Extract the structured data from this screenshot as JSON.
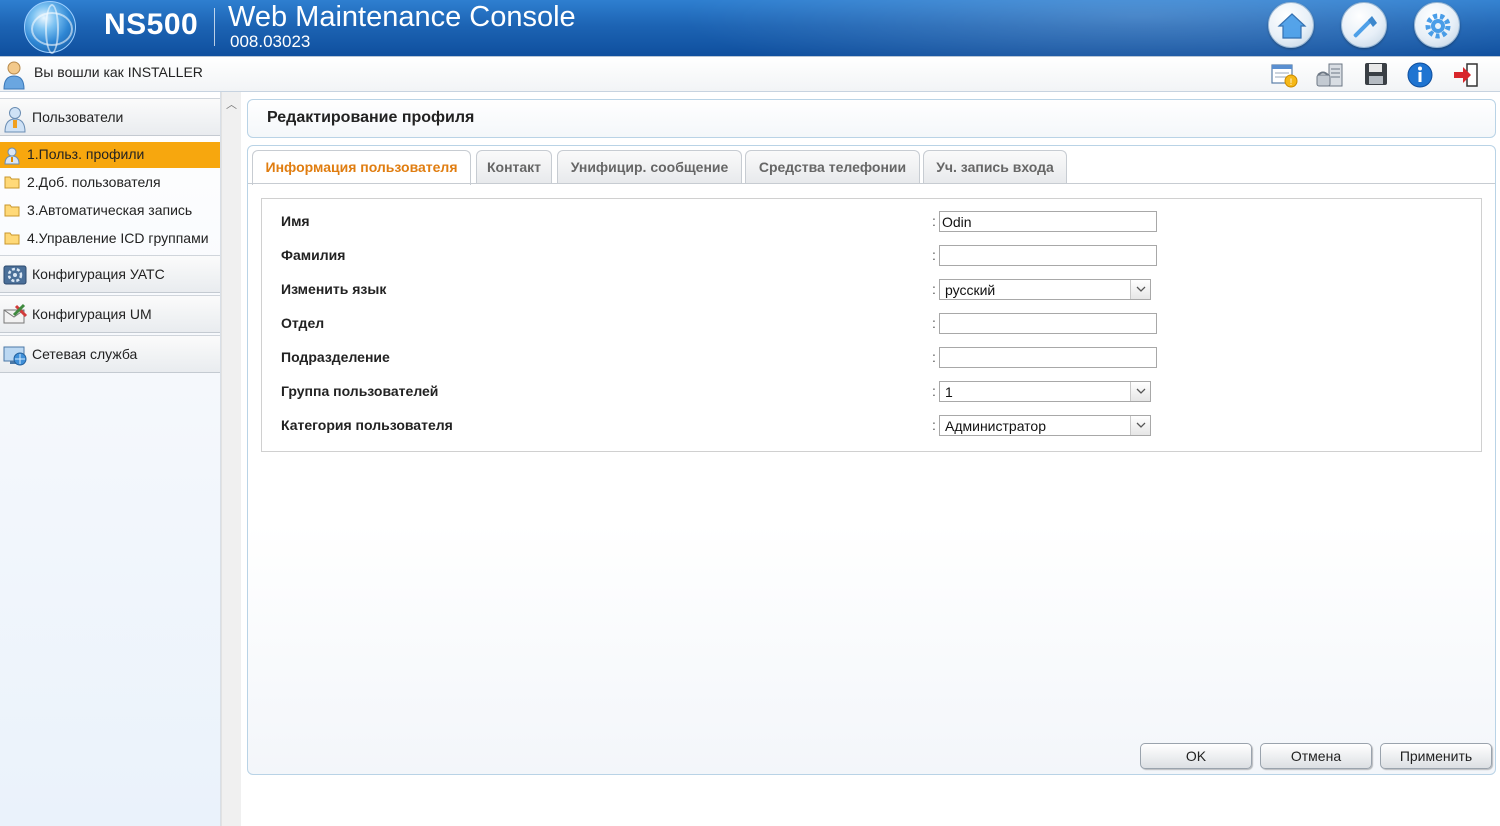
{
  "header": {
    "model": "NS500",
    "title": "Web Maintenance Console",
    "version": "008.03023",
    "buttons": [
      {
        "icon": "home-icon"
      },
      {
        "icon": "tool-icon"
      },
      {
        "icon": "gear-icon"
      }
    ]
  },
  "userbar": {
    "login_text": "Вы вошли как INSTALLER",
    "icons": [
      "calendar-alert-icon",
      "phone-system-icon",
      "save-icon",
      "info-icon",
      "logout-icon"
    ]
  },
  "sidebar": {
    "groups": [
      {
        "label": "Пользователи",
        "icon": "user-group-icon"
      },
      {
        "label": "Конфигурация УАТС",
        "icon": "pbx-config-icon"
      },
      {
        "label": "Конфигурация UM",
        "icon": "um-config-icon"
      },
      {
        "label": "Сетевая служба",
        "icon": "network-service-icon"
      }
    ],
    "items": [
      {
        "label": "1.Польз. профили",
        "active": true
      },
      {
        "label": "2.Доб. пользователя",
        "active": false
      },
      {
        "label": "3.Автоматическая запись",
        "active": false
      },
      {
        "label": "4.Управление ICD группами",
        "active": false
      }
    ]
  },
  "main": {
    "page_title": "Редактирование профиля",
    "tabs": [
      {
        "label": "Информация пользователя",
        "active": true
      },
      {
        "label": "Контакт",
        "active": false
      },
      {
        "label": "Унифицир. сообщение",
        "active": false
      },
      {
        "label": "Средства телефонии",
        "active": false
      },
      {
        "label": "Уч. запись входа",
        "active": false
      }
    ],
    "form": {
      "first_name": {
        "label": "Имя",
        "value": "Odin"
      },
      "last_name": {
        "label": "Фамилия",
        "value": ""
      },
      "language": {
        "label": "Изменить язык",
        "value": "русский"
      },
      "department": {
        "label": "Отдел",
        "value": ""
      },
      "division": {
        "label": "Подразделение",
        "value": ""
      },
      "user_group": {
        "label": "Группа пользователей",
        "value": "1"
      },
      "user_category": {
        "label": "Категория пользователя",
        "value": "Администратор"
      }
    },
    "buttons": {
      "ok": "OK",
      "cancel": "Отмена",
      "apply": "Применить"
    }
  },
  "colors": {
    "header_blue": "#1d64b4",
    "active_nav": "#f7a70e",
    "active_tab_text": "#e07d10"
  }
}
